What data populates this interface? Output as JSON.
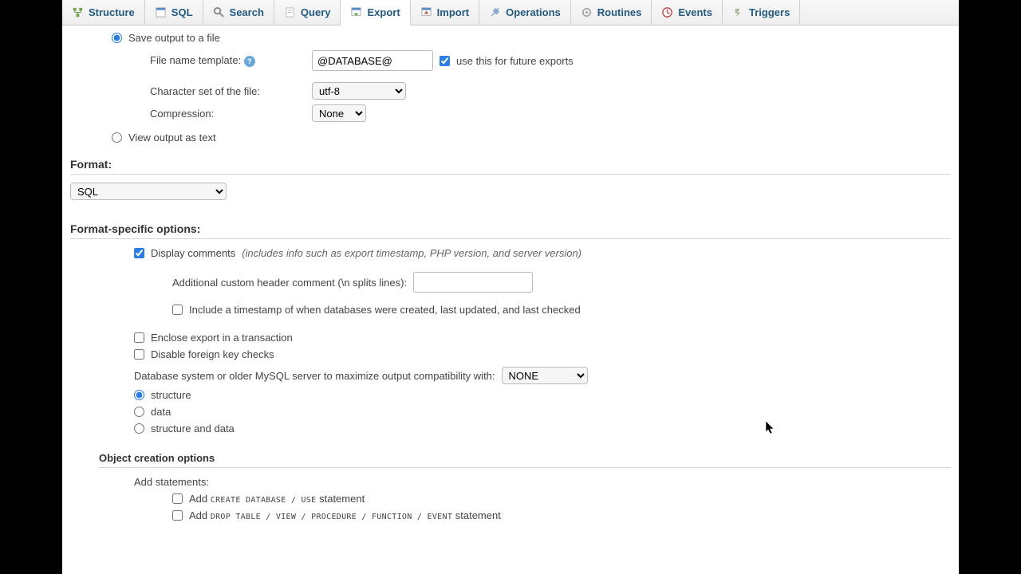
{
  "tabs": [
    {
      "label": "Structure"
    },
    {
      "label": "SQL"
    },
    {
      "label": "Search"
    },
    {
      "label": "Query"
    },
    {
      "label": "Export"
    },
    {
      "label": "Import"
    },
    {
      "label": "Operations"
    },
    {
      "label": "Routines"
    },
    {
      "label": "Events"
    },
    {
      "label": "Triggers"
    }
  ],
  "active_tab": "Export",
  "output": {
    "save_to_file": "Save output to a file",
    "filename_label": "File name template:",
    "filename_value": "@DATABASE@",
    "future_label": "use this for future exports",
    "charset_label": "Character set of the file:",
    "charset_value": "utf-8",
    "compression_label": "Compression:",
    "compression_value": "None",
    "view_as_text": "View output as text"
  },
  "format": {
    "header": "Format:",
    "value": "SQL"
  },
  "format_specific": {
    "header": "Format-specific options:",
    "display_comments": "Display comments",
    "display_comments_note": "(includes info such as export timestamp, PHP version, and server version)",
    "additional_header": "Additional custom header comment (\\n splits lines):",
    "include_timestamp": "Include a timestamp of when databases were created, last updated, and last checked",
    "enclose_tx": "Enclose export in a transaction",
    "disable_fk": "Disable foreign key checks",
    "compat_label": "Database system or older MySQL server to maximize output compatibility with:",
    "compat_value": "NONE",
    "dump_structure": "structure",
    "dump_data": "data",
    "dump_both": "structure and data"
  },
  "object_creation": {
    "header": "Object creation options",
    "add_statements": "Add statements:",
    "add_create_db_pre": "Add ",
    "add_create_db_code": "CREATE DATABASE / USE",
    "add_create_db_post": " statement",
    "add_drop_pre": "Add ",
    "add_drop_code": "DROP TABLE / VIEW / PROCEDURE / FUNCTION / EVENT",
    "add_drop_post": " statement"
  }
}
